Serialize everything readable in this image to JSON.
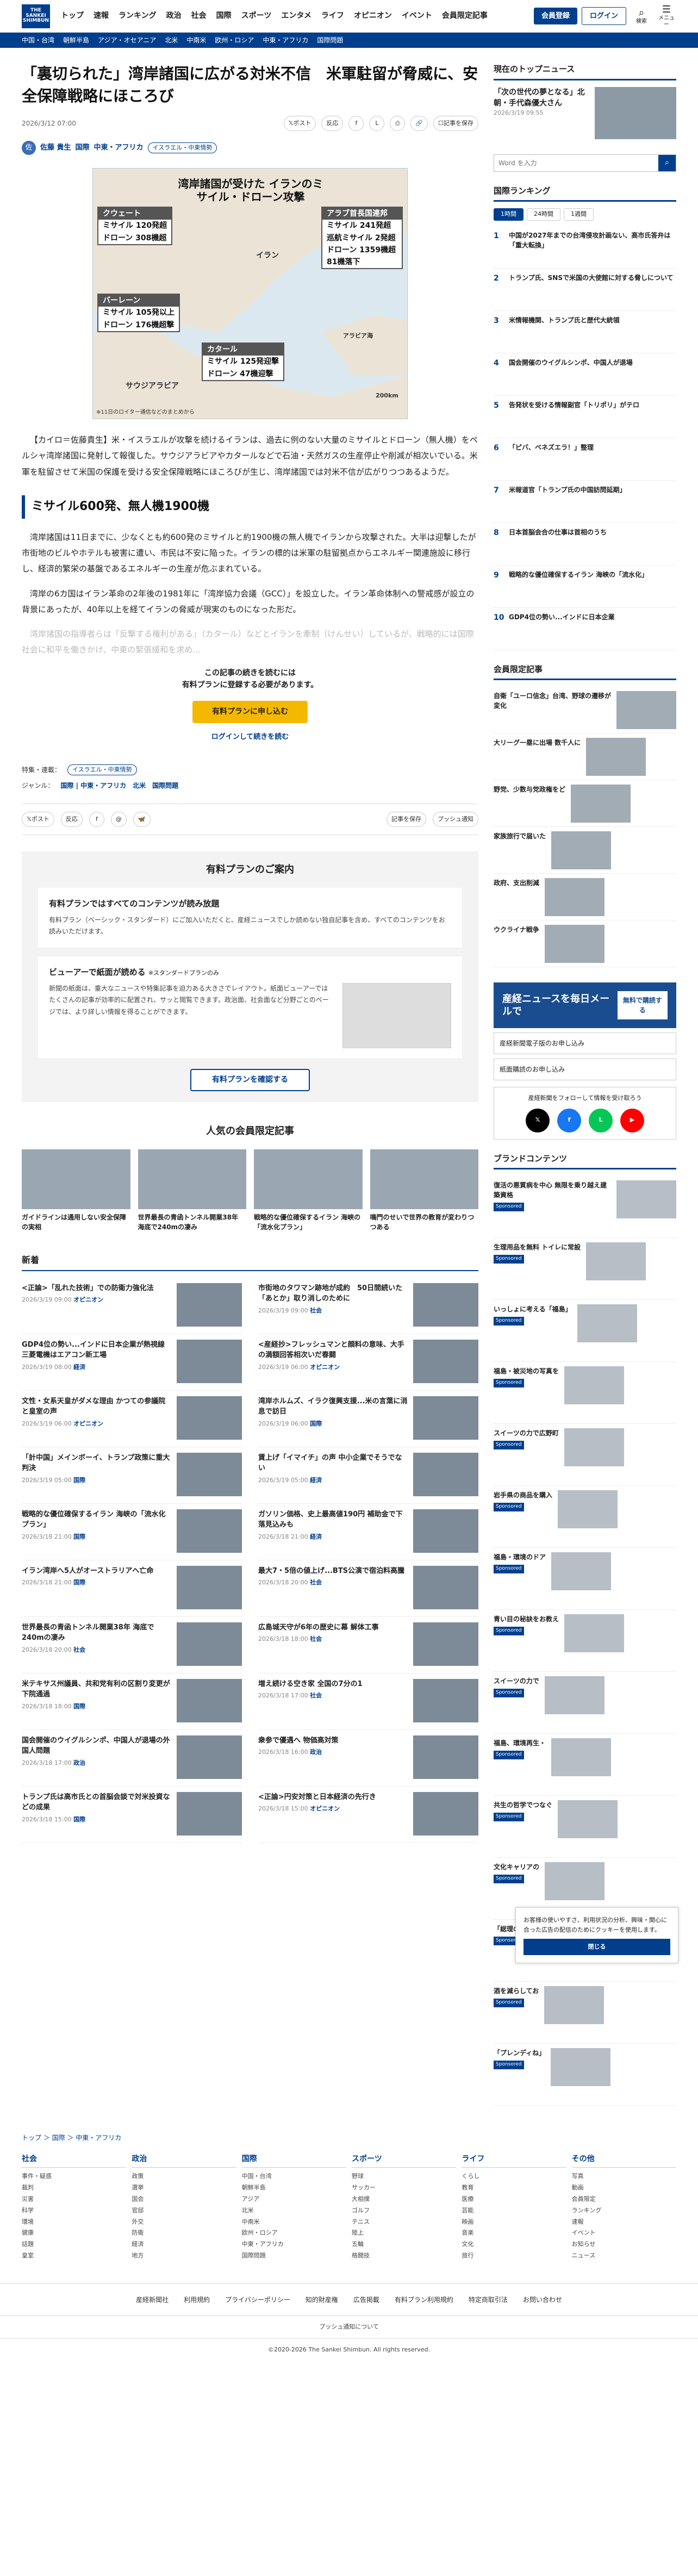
{
  "header": {
    "logo": "THE SANKEI SHIMBUN",
    "nav": [
      "トップ",
      "速報",
      "ランキング",
      "政治",
      "社会",
      "国際",
      "スポーツ",
      "エンタメ",
      "ライフ",
      "オピニオン",
      "イベント",
      "会員限定記事"
    ],
    "register": "会員登録",
    "login": "ログイン",
    "search": "検索",
    "menu": "メニュー"
  },
  "subnav": [
    "中国・台湾",
    "朝鮮半島",
    "アジア・オセアニア",
    "北米",
    "中南米",
    "欧州・ロシア",
    "中東・アフリカ",
    "国際問題"
  ],
  "article": {
    "title": "「裏切られた」湾岸諸国に広がる対米不信　米軍駐留が脅威に、安全保障戦略にほころび",
    "date": "2026/3/12 07:00",
    "share": [
      "ポスト",
      "反応",
      "記事を保存"
    ],
    "author": "佐藤 貴生",
    "author_initial": "佐",
    "category": "国際",
    "category_sub": "中東・アフリカ",
    "tag": "イスラエル・中東情勢",
    "map": {
      "title": "湾岸諸国が受けた イランのミサイル・ドローン攻撃",
      "kuwait": {
        "name": "クウェート",
        "rows": [
          "ミサイル 120発超",
          "ドローン 308機超"
        ]
      },
      "uae": {
        "name": "アラブ首長国連邦",
        "rows": [
          "ミサイル 241発超",
          "巡航ミサイル 2発超",
          "ドローン 1359機超",
          "81機落下"
        ]
      },
      "bahrain": {
        "name": "バーレーン",
        "rows": [
          "ミサイル 105発以上",
          "ドローン 176機超撃"
        ]
      },
      "qatar": {
        "name": "カタール",
        "rows": [
          "ミサイル 125発迎撃",
          "ドローン 47機迎撃"
        ]
      },
      "iran": "イラン",
      "saudi": "サウジアラビア",
      "oman": "アラビア海",
      "scale": "200km",
      "note": "※11日のロイター通信などのまとめから"
    },
    "lead": "【カイロ＝佐藤貴生】米・イスラエルが攻撃を続けるイランは、過去に例のない大量のミサイルとドローン（無人機）をペルシャ湾岸諸国に発射して報復した。サウジアラビアやカタールなどで石油・天然ガスの生産停止や削減が相次いでいる。米軍を駐留させて米国の保護を受ける安全保障戦略にほころびが生じ、湾岸諸国では対米不信が広がりつつあるようだ。",
    "h2": "ミサイル600発、無人機1900機",
    "p1": "湾岸諸国は11日までに、少なくとも約600発のミサイルと約1900機の無人機でイランから攻撃された。大半は迎撃したが市街地のビルやホテルも被害に遭い、市民は不安に陥った。イランの標的は米軍の駐留拠点からエネルギー関連施設に移行し、経済的繁栄の基盤であるエネルギーの生産が危ぶまれている。",
    "p2": "湾岸の6カ国はイラン革命の2年後の1981年に「湾岸協力会議（GCC）」を設立した。イラン革命体制への警戒感が設立の背景にあったが、40年以上を経てイランの脅威が現実のものになった形だ。",
    "p3": "湾岸諸国の指導者らは「反撃する権利がある」（カタール）などとイランを牽制（けんせい）しているが、戦略的には国際社会に和平を働きかけ、中東の緊張緩和を求め..."
  },
  "paywall": {
    "text1": "この記事の続きを読むには",
    "text2": "有料プランに登録する必要があります。",
    "button": "有料プランに申し込む",
    "login": "ログインして続きを読む"
  },
  "tags": {
    "feature_label": "特集・連載：",
    "feature": "イスラエル・中東情勢",
    "genre_label": "ジャンル：",
    "genre": "国際 | 中東・アフリカ　北米　国際問題"
  },
  "share2": [
    "ポスト",
    "反応",
    "記事を保存",
    "プッシュ通知"
  ],
  "plan": {
    "title": "有料プランのご案内",
    "c1_h": "有料プランではすべてのコンテンツが読み放題",
    "c1_d": "有料プラン（ベーシック・スタンダード）にご加入いただくと、産経ニュースでしか読めない独自記事を含め、すべてのコンテンツをお読みいただけます。",
    "c2_h": "ビューアーで紙面が読める",
    "c2_badge": "※スタンダードプランのみ",
    "c2_d": "新聞の紙面は、重大なニュースや特集記事を迫力ある大きさでレイアウト。紙面ビューアーではたくさんの記事が効率的に配置され、サッと閲覧できます。政治面、社会面など分野ごとのページでは、より詳しい情報を得ることができます。",
    "button": "有料プランを確認する"
  },
  "popular": {
    "title": "人気の会員限定記事",
    "items": [
      "ガイドラインは通用しない安全保障の実相",
      "世界最長の青函トンネル開業38年 海底で240mの凄み",
      "戦略的な優位確保するイラン 海峡の「流水化プラン」",
      "鳴門のせいで世界の教育が変わりつつある"
    ]
  },
  "news": {
    "title": "新着",
    "items": [
      {
        "t": "<正論>「乱れた技術」での防衛力強化法",
        "d": "2026/3/19 09:00",
        "tag": "オピニオン"
      },
      {
        "t": "市街地のタワマン跡地が成約　50日間続いた「あとか」取り消しのために",
        "d": "2026/3/19 09:00",
        "tag": "社会"
      },
      {
        "t": "GDP4位の勢い...インドに日本企業が熱視線 三菱電機はエアコン新工場",
        "d": "2026/3/19 08:00",
        "tag": "経済"
      },
      {
        "t": "<産経抄>フレッシュマンと顔料の意味、大手の満額回答相次いだ春闘",
        "d": "2026/3/19 06:00",
        "tag": "オピニオン"
      },
      {
        "t": "文性・女系天皇がダメな理由 かつての参議院と皇室の声",
        "d": "2026/3/19 06:00",
        "tag": "オピニオン"
      },
      {
        "t": "湾岸ホルムズ、イラク復興支援...米の言葉に消息で訪日",
        "d": "2026/3/19 06:00",
        "tag": "国際"
      },
      {
        "t": "「計中国」メインボーイ、トランプ政策に重大判決",
        "d": "2026/3/19 05:00",
        "tag": "国際"
      },
      {
        "t": "賃上げ「イマイチ」の声 中小企業でそうでない",
        "d": "2026/3/19 05:00",
        "tag": "経済"
      },
      {
        "t": "戦略的な優位確保するイラン 海峡の「流水化プラン」",
        "d": "2026/3/18 21:00",
        "tag": "国際"
      },
      {
        "t": "ガソリン価格、史上最高値190円 補助金で下落見込みも",
        "d": "2026/3/18 21:00",
        "tag": "経済"
      },
      {
        "t": "イラン湾岸へ5人がオーストラリアへ亡命",
        "d": "2026/3/18 21:00",
        "tag": "国際"
      },
      {
        "t": "最大7・5倍の値上げ...BTS公演で宿泊料高騰",
        "d": "2026/3/18 20:00",
        "tag": "社会"
      },
      {
        "t": "世界最長の青函トンネル開業38年 海底で240mの凄み",
        "d": "2026/3/18 20:00",
        "tag": "社会"
      },
      {
        "t": "広島城天守が6年の歴史に幕 解体工事",
        "d": "2026/3/18 18:00",
        "tag": "社会"
      },
      {
        "t": "米テキサス州議員、共和党有利の区割り変更が下院通過",
        "d": "2026/3/18 18:00",
        "tag": "国際"
      },
      {
        "t": "増え続ける空き家 全国の7分の1",
        "d": "2026/3/18 17:00",
        "tag": "社会"
      },
      {
        "t": "国会開催のウイグルシンポ、中国人が退場の外国人問題",
        "d": "2026/3/18 17:00",
        "tag": "政治"
      },
      {
        "t": "衆参で優遇へ 物価高対策",
        "d": "2026/3/18 16:00",
        "tag": "政治"
      },
      {
        "t": "トランプ氏は高市氏との首脳会談で対米投資などの成果",
        "d": "2026/3/18 15:00",
        "tag": "国際"
      },
      {
        "t": "<正論>円安対策と日本経済の先行き",
        "d": "2026/3/18 15:00",
        "tag": "オピニオン"
      }
    ]
  },
  "breadcrumb": "トップ ＞ 国際 ＞ 中東・アフリカ",
  "footer": {
    "cols": [
      {
        "h": "社会",
        "items": [
          "事件・疑惑",
          "裁判",
          "災害",
          "科学",
          "環境",
          "健康",
          "話題",
          "皇室"
        ]
      },
      {
        "h": "政治",
        "items": [
          "政策",
          "選挙",
          "国会",
          "官邸",
          "外交",
          "防衛",
          "経済",
          "地方"
        ]
      },
      {
        "h": "国際",
        "items": [
          "中国・台湾",
          "朝鮮半島",
          "アジア",
          "北米",
          "中南米",
          "欧州・ロシア",
          "中東・アフリカ",
          "国際問題"
        ]
      },
      {
        "h": "スポーツ",
        "items": [
          "野球",
          "サッカー",
          "大相撲",
          "ゴルフ",
          "テニス",
          "陸上",
          "五輪",
          "格闘技"
        ]
      },
      {
        "h": "ライフ",
        "items": [
          "くらし",
          "教育",
          "医療",
          "芸能",
          "映画",
          "音楽",
          "文化",
          "旅行"
        ]
      },
      {
        "h": "その他",
        "items": [
          "写真",
          "動画",
          "会員限定",
          "ランキング",
          "速報",
          "イベント",
          "お知らせ",
          "ニュース"
        ]
      }
    ],
    "links": [
      "産経新聞社",
      "利用規約",
      "プライバシーポリシー",
      "知的財産権",
      "広告掲載",
      "有料プラン利用規約",
      "特定商取引法",
      "お問い合わせ"
    ],
    "push": "プッシュ通知について",
    "copyright": "©2020-2026 The Sankei Shimbun. All rights reserved."
  },
  "side": {
    "top_title": "現在のトップニュース",
    "top_news": "「次の世代の夢となる」北朝・手代森優大さん",
    "top_date": "2026/3/19 09:55",
    "search_placeholder": "Word を入力",
    "rank_title": "国際ランキング",
    "rank_tabs": [
      "1時間",
      "24時間",
      "1週間"
    ],
    "rank": [
      "中国が2027年までの台湾侵攻計画ない、高市氏答弁は「重大転換」",
      "トランプ氏、SNSで米国の大使館に対する脅しについて",
      "米情報機関、トランプ氏と歴代大統領",
      "国会開催のウイグルシンポ、中国人が退場",
      "告発状を受ける情報副官「トリポリ」がテロ",
      "「ピバ、ベネズエラ！」整理",
      "米報道官「トランプ氏の中国訪問延期」",
      "日本首脳会合の仕事は首相のうち",
      "戦略的な優位確保するイラン 海峡の「流水化」",
      "GDP4位の勢い...インドに日本企業"
    ],
    "mem_title": "会員限定記事",
    "mem": [
      "自衛「ユーロ信念」台湾、野球の遷移が変化",
      "大リーグ一塁に出場 数千人に",
      "野党、少数与党政権をど",
      "家族旅行で届いた",
      "政府、支出削減",
      "ウクライナ戦争"
    ],
    "banner": "産経ニュースを毎日メールで",
    "banner_btn": "無料で購読する",
    "links": [
      "産経新聞電子版のお申し込み",
      "紙面購読のお申し込み"
    ],
    "sns_title": "産経新聞をフォローして情報を受け取ろう",
    "brand_title": "ブランドコンテンツ",
    "brand": [
      "復活の悪質病を中心 無限を乗り越え建築資格",
      "生理用品を無料 トイレに常設",
      "いっしょに考える「福島」",
      "福島・被災地の写真を",
      "スイーツの力で広野町",
      "岩手県の商品を購入",
      "福島・環境のドア",
      "青い目の秘訣をお教え",
      "スイーツの力で",
      "福島、環境再生・",
      "共生の哲学でつなぐ",
      "文化キャリアの",
      "「総理の考え」",
      "酒を減らしてお",
      "「プレンディね」"
    ],
    "sponsored": "Sponsored"
  },
  "cookie": {
    "text": "お客様の使いやすさ、利用状況の分析、興味・関心に合った広告の配信のためにクッキーを使用します。",
    "button": "閉じる"
  }
}
